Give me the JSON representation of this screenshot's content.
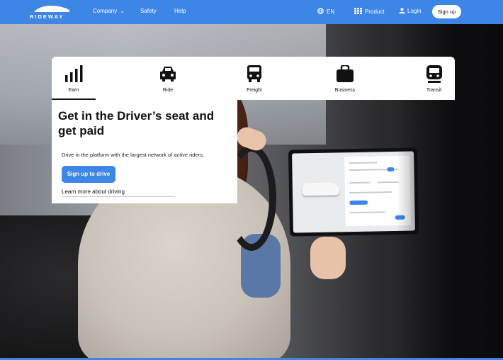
{
  "nav": {
    "logo_text": "RIDEWAY",
    "company": "Company",
    "safety": "Safety",
    "help": "Help",
    "language": "EN",
    "product": "Product",
    "login": "Login",
    "signup": "Sign up"
  },
  "tabs": [
    {
      "label": "Earn",
      "icon": "bars-icon",
      "active": true
    },
    {
      "label": "Ride",
      "icon": "car-icon",
      "active": false
    },
    {
      "label": "Freight",
      "icon": "truck-icon",
      "active": false
    },
    {
      "label": "Business",
      "icon": "briefcase-icon",
      "active": false
    },
    {
      "label": "Transit",
      "icon": "train-icon",
      "active": false
    }
  ],
  "hero": {
    "headline": "Get in the Driver’s seat and get paid",
    "description": "Drive in the platform with the largest network of active riders.",
    "cta": "Sign up to drive",
    "learn_more": "Learn more about driving"
  },
  "colors": {
    "accent": "#3d86e6",
    "card": "#ffffff",
    "text": "#111111"
  }
}
